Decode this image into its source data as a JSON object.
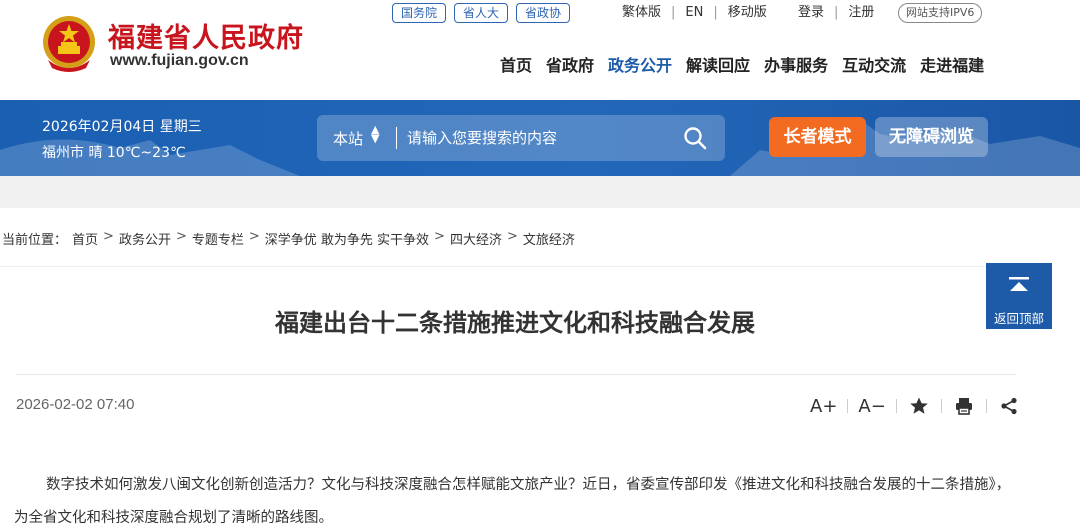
{
  "header": {
    "site_name": "福建省人民政府",
    "site_url": "www.fujian.gov.cn",
    "top_links": [
      "国务院",
      "省人大",
      "省政协"
    ],
    "lang_links": [
      "繁体版",
      "EN",
      "移动版"
    ],
    "user_links": [
      "登录",
      "注册"
    ],
    "ipv6_badge": "网站支持IPV6",
    "nav": [
      "首页",
      "省政府",
      "政务公开",
      "解读回应",
      "办事服务",
      "互动交流",
      "走进福建"
    ],
    "nav_active_index": 2
  },
  "banner": {
    "date": "2026年02月04日 星期三",
    "weather": "福州市 晴 10℃~23℃",
    "search_scope": "本站",
    "search_placeholder": "请输入您要搜索的内容",
    "elder_mode": "长者模式",
    "accessible": "无障碍浏览"
  },
  "breadcrumb": {
    "prefix": "当前位置：",
    "items": [
      "首页",
      "政务公开",
      "专题专栏",
      "深学争优 敢为争先 实干争效",
      "四大经济",
      "文旅经济"
    ],
    "separator": ">"
  },
  "back_to_top": "返回顶部",
  "article": {
    "title": "福建出台十二条措施推进文化和科技融合发展",
    "date": "2026-02-02 07:40",
    "font_larger": "A+",
    "font_smaller": "A−",
    "paragraph": "数字技术如何激发八闽文化创新创造活力？文化与科技深度融合怎样赋能文旅产业？近日，省委宣传部印发《推进文化和科技融合发展的十二条措施》，为全省文化和科技深度融合规划了清晰的路线图。"
  },
  "colors": {
    "brand_red": "#c8151d",
    "brand_blue": "#1d5aa8",
    "elder_orange": "#f26b21"
  }
}
